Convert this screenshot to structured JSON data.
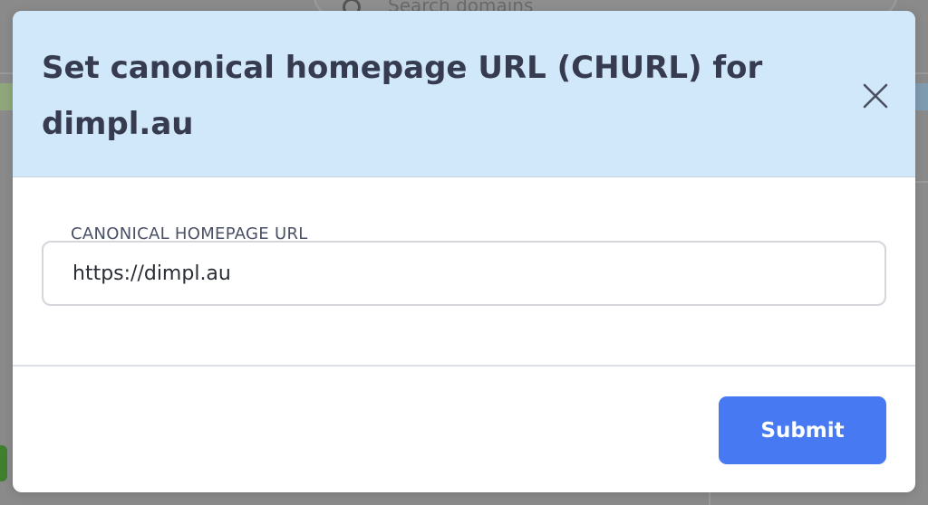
{
  "background": {
    "search_placeholder": "Search domains"
  },
  "modal": {
    "title": "Set canonical homepage URL (CHURL) for dimpl.au",
    "close_icon": "close-icon",
    "field": {
      "label": "CANONICAL HOMEPAGE URL",
      "value": "https://dimpl.au"
    },
    "submit_label": "Submit"
  },
  "colors": {
    "header_background": "#d0e8fa",
    "title_text": "#363b4f",
    "submit_background": "#4679f2",
    "submit_text": "#ffffff",
    "overlay": "#8a8a8a"
  }
}
